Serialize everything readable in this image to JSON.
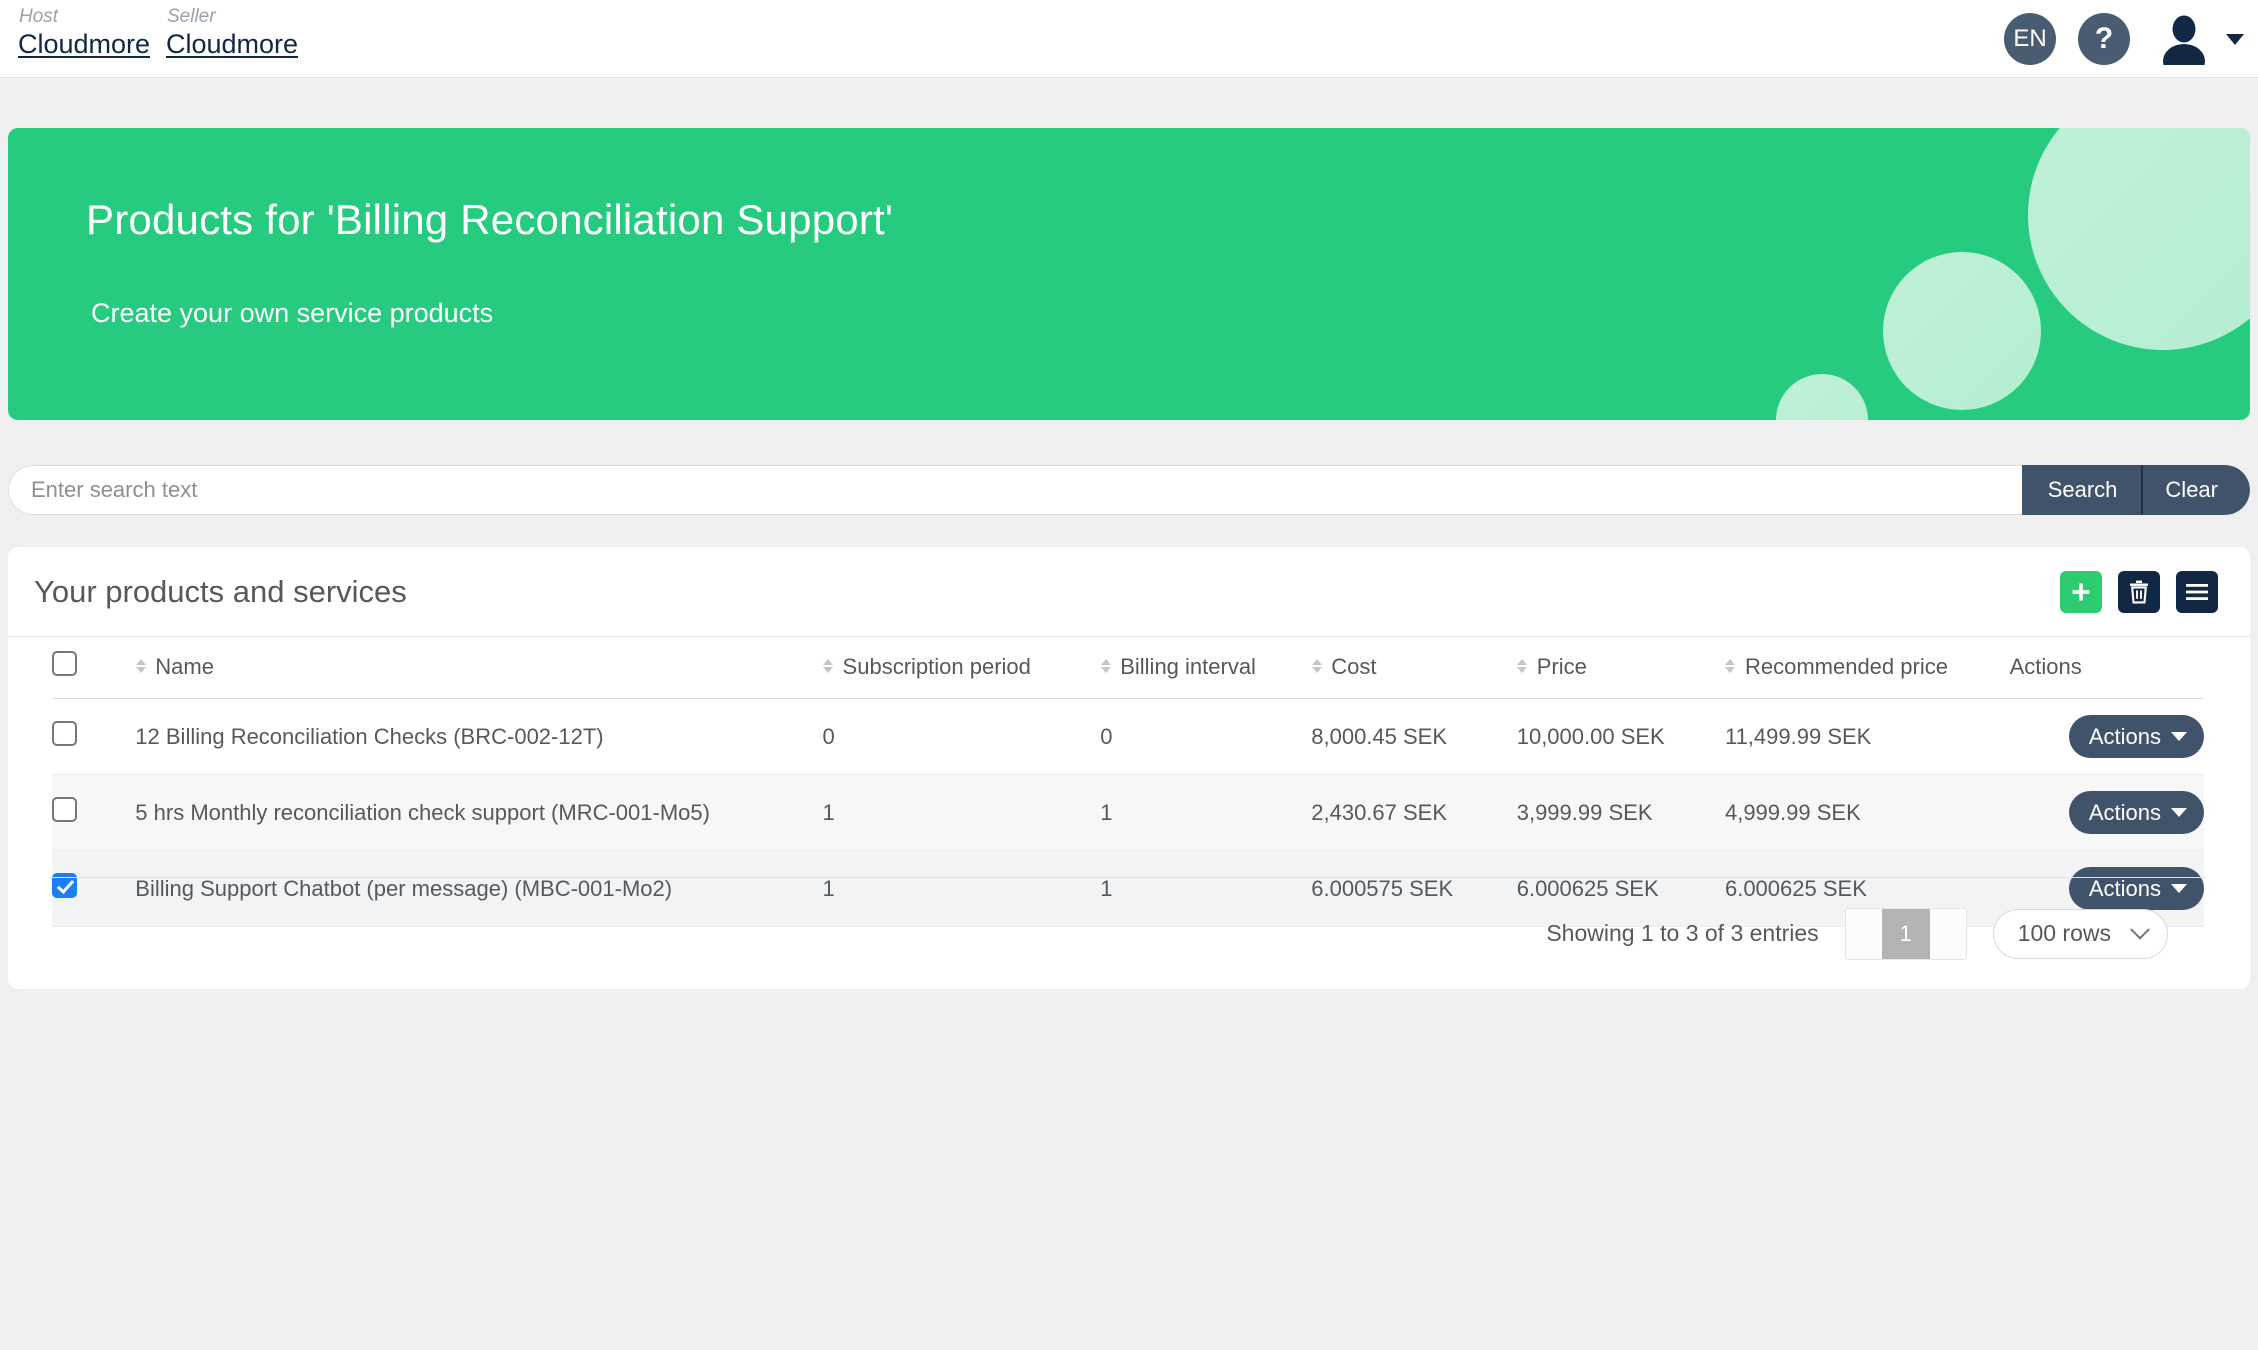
{
  "topbar": {
    "host_label": "Host",
    "host_value": "Cloudmore",
    "seller_label": "Seller",
    "seller_value": "Cloudmore",
    "language": "EN",
    "help": "?"
  },
  "hero": {
    "title": "Products for 'Billing Reconciliation Support'",
    "subtitle": "Create your own service products",
    "background_color": "#27cb7f"
  },
  "search": {
    "placeholder": "Enter search text",
    "value": "",
    "search_label": "Search",
    "clear_label": "Clear"
  },
  "card": {
    "title": "Your products and services",
    "add_label": "+",
    "delete_label": "delete",
    "menu_label": "menu"
  },
  "table": {
    "headers": {
      "name": "Name",
      "subscription_period": "Subscription period",
      "billing_interval": "Billing interval",
      "cost": "Cost",
      "price": "Price",
      "recommended_price": "Recommended price",
      "actions": "Actions"
    },
    "action_button_label": "Actions",
    "rows": [
      {
        "selected": false,
        "name": "12 Billing Reconciliation Checks (BRC-002-12T)",
        "subscription_period": "0",
        "billing_interval": "0",
        "cost": "8,000.45 SEK",
        "price": "10,000.00 SEK",
        "recommended_price": "11,499.99 SEK"
      },
      {
        "selected": false,
        "name": "5 hrs Monthly reconciliation check support (MRC-001-Mo5)",
        "subscription_period": "1",
        "billing_interval": "1",
        "cost": "2,430.67 SEK",
        "price": "3,999.99 SEK",
        "recommended_price": "4,999.99 SEK"
      },
      {
        "selected": true,
        "name": "Billing Support Chatbot (per message) (MBC-001-Mo2)",
        "subscription_period": "1",
        "billing_interval": "1",
        "cost": "6.000575 SEK",
        "price": "6.000625 SEK",
        "recommended_price": "6.000625 SEK"
      }
    ]
  },
  "footer": {
    "showing": "Showing 1 to 3 of 3 entries",
    "current_page": "1",
    "rows_per_page": "100 rows"
  },
  "colors": {
    "accent_green": "#2ecc71",
    "dark_navy": "#122744",
    "slate": "#41536b",
    "checkbox_blue": "#1a7ff2"
  }
}
